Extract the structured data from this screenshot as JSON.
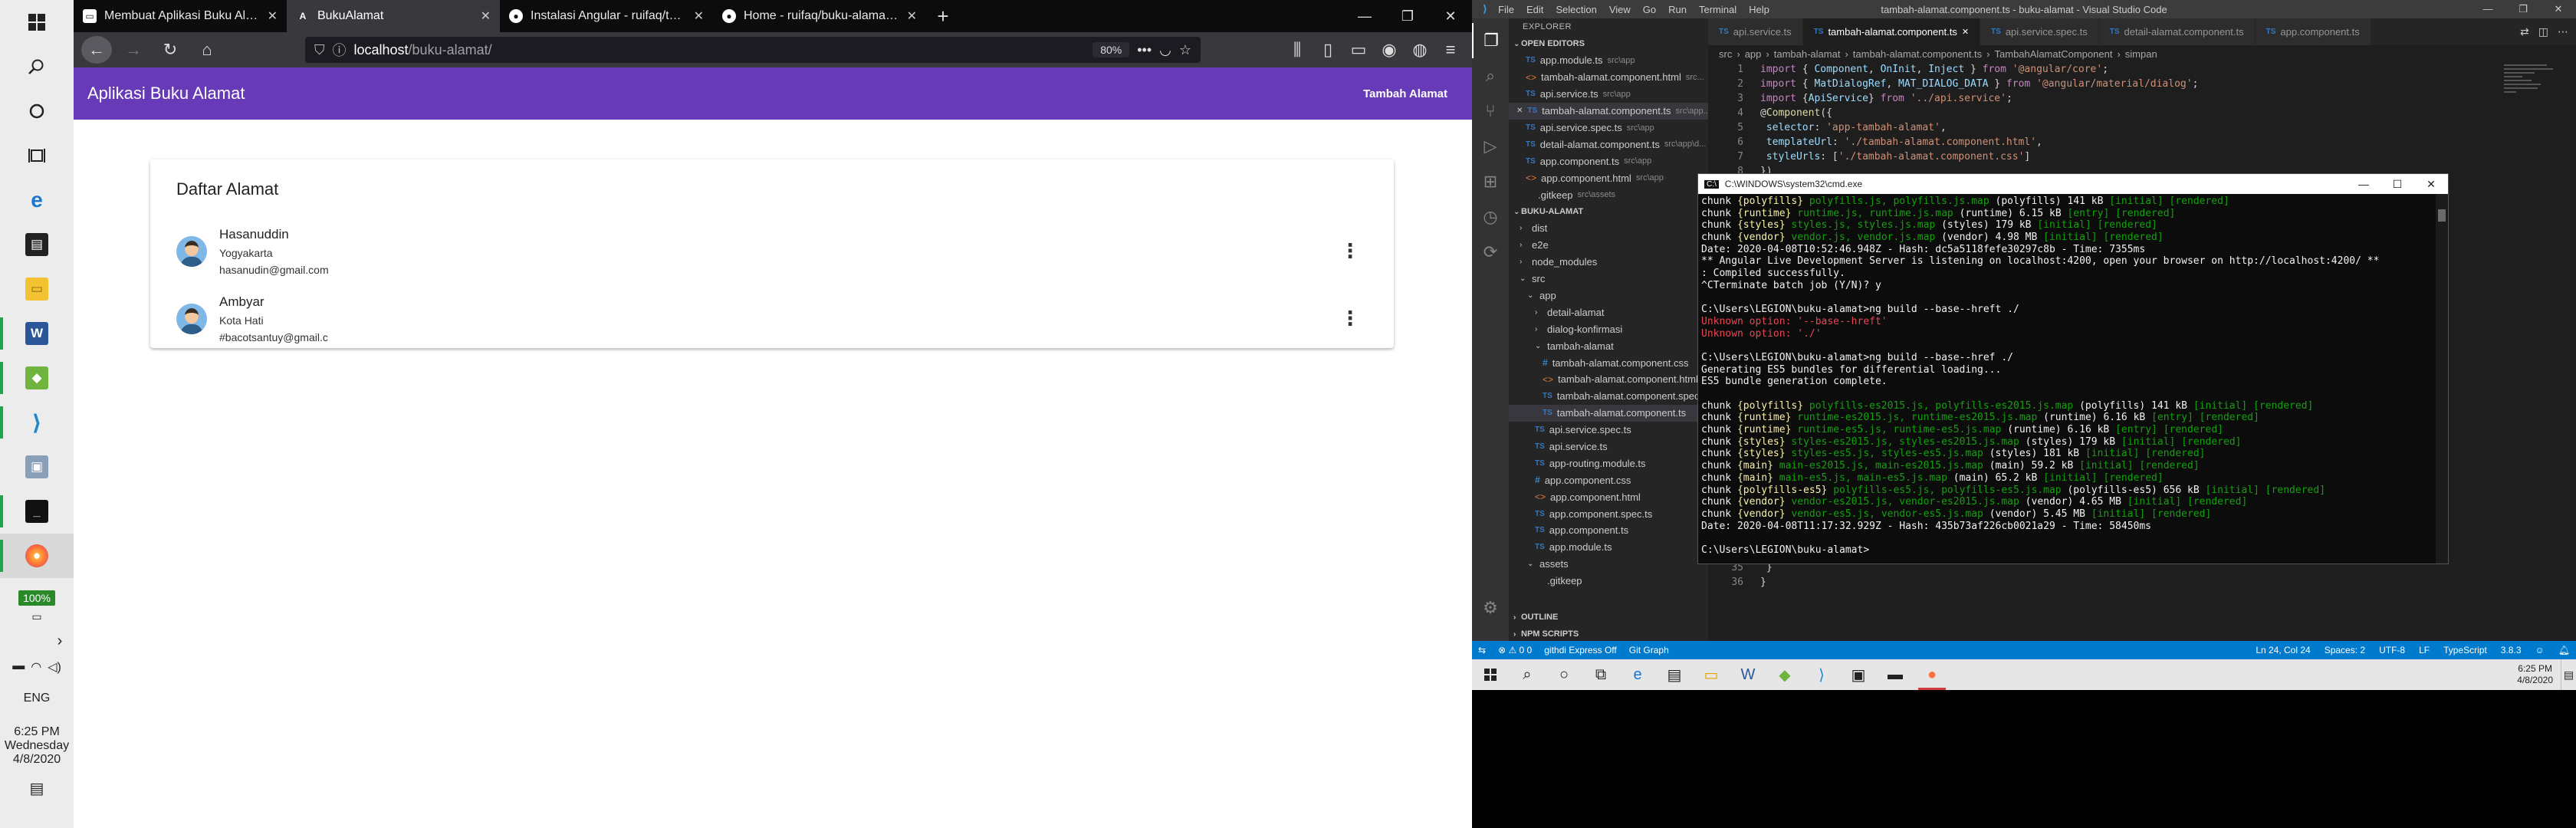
{
  "left_taskbar": {
    "battery": "100%",
    "language": "ENG",
    "time": "6:25 PM",
    "day": "Wednesday",
    "date": "4/8/2020"
  },
  "firefox": {
    "tabs": [
      {
        "title": "Membuat Aplikasi Buku Alamat Me",
        "active": false
      },
      {
        "title": "BukuAlamat",
        "active": true
      },
      {
        "title": "Instalasi Angular - ruifaq/tekw",
        "active": false
      },
      {
        "title": "Home - ruifaq/buku-alamat W",
        "active": false
      }
    ],
    "url_host": "localhost",
    "url_path": "/buku-alamat/",
    "zoom": "80%"
  },
  "app": {
    "title": "Aplikasi Buku Alamat",
    "add_button": "Tambah Alamat",
    "card_title": "Daftar Alamat",
    "addresses": [
      {
        "name": "Hasanuddin",
        "city": "Yogyakarta",
        "email": "hasanudin@gmail.com"
      },
      {
        "name": "Ambyar",
        "city": "Kota Hati",
        "email": "#bacotsantuy@gmail.c"
      }
    ]
  },
  "vscode": {
    "window_title": "tambah-alamat.component.ts - buku-alamat - Visual Studio Code",
    "menus": [
      "File",
      "Edit",
      "Selection",
      "View",
      "Go",
      "Run",
      "Terminal",
      "Help"
    ],
    "explorer_label": "EXPLORER",
    "open_editors_label": "OPEN EDITORS",
    "open_editors": [
      {
        "name": "app.module.ts",
        "path": "src\\app",
        "icon": "ts"
      },
      {
        "name": "tambah-alamat.component.html",
        "path": "src...",
        "icon": "html"
      },
      {
        "name": "api.service.ts",
        "path": "src\\app",
        "icon": "ts"
      },
      {
        "name": "tambah-alamat.component.ts",
        "path": "src\\app...",
        "icon": "ts",
        "selected": true
      },
      {
        "name": "api.service.spec.ts",
        "path": "src\\app",
        "icon": "ts"
      },
      {
        "name": "detail-alamat.component.ts",
        "path": "src\\app\\d...",
        "icon": "ts"
      },
      {
        "name": "app.component.ts",
        "path": "src\\app",
        "icon": "ts"
      },
      {
        "name": "app.component.html",
        "path": "src\\app",
        "icon": "html"
      },
      {
        "name": ".gitkeep",
        "path": "src\\assets",
        "icon": "none"
      }
    ],
    "project_label": "BUKU-ALAMAT",
    "tree": [
      {
        "name": "dist",
        "level": 0,
        "kind": "folder-closed"
      },
      {
        "name": "e2e",
        "level": 0,
        "kind": "folder-closed"
      },
      {
        "name": "node_modules",
        "level": 0,
        "kind": "folder-closed"
      },
      {
        "name": "src",
        "level": 0,
        "kind": "folder-open"
      },
      {
        "name": "app",
        "level": 1,
        "kind": "folder-open"
      },
      {
        "name": "detail-alamat",
        "level": 2,
        "kind": "folder-closed"
      },
      {
        "name": "dialog-konfirmasi",
        "level": 2,
        "kind": "folder-closed"
      },
      {
        "name": "tambah-alamat",
        "level": 2,
        "kind": "folder-open"
      },
      {
        "name": "tambah-alamat.component.css",
        "level": 3,
        "kind": "css"
      },
      {
        "name": "tambah-alamat.component.html",
        "level": 3,
        "kind": "html"
      },
      {
        "name": "tambah-alamat.component.spec.ts",
        "level": 3,
        "kind": "ts"
      },
      {
        "name": "tambah-alamat.component.ts",
        "level": 3,
        "kind": "ts",
        "selected": true
      },
      {
        "name": "api.service.spec.ts",
        "level": 2,
        "kind": "ts"
      },
      {
        "name": "api.service.ts",
        "level": 2,
        "kind": "ts"
      },
      {
        "name": "app-routing.module.ts",
        "level": 2,
        "kind": "ts"
      },
      {
        "name": "app.component.css",
        "level": 2,
        "kind": "css"
      },
      {
        "name": "app.component.html",
        "level": 2,
        "kind": "html"
      },
      {
        "name": "app.component.spec.ts",
        "level": 2,
        "kind": "ts"
      },
      {
        "name": "app.component.ts",
        "level": 2,
        "kind": "ts"
      },
      {
        "name": "app.module.ts",
        "level": 2,
        "kind": "ts"
      },
      {
        "name": "assets",
        "level": 1,
        "kind": "folder-open"
      },
      {
        "name": ".gitkeep",
        "level": 2,
        "kind": "none"
      }
    ],
    "outline_label": "OUTLINE",
    "npm_label": "NPM SCRIPTS",
    "editor_tabs": [
      {
        "name": "api.service.ts",
        "active": false
      },
      {
        "name": "tambah-alamat.component.ts",
        "active": true
      },
      {
        "name": "api.service.spec.ts",
        "active": false
      },
      {
        "name": "detail-alamat.component.ts",
        "active": false
      },
      {
        "name": "app.component.ts",
        "active": false
      }
    ],
    "breadcrumb": [
      "src",
      "app",
      "tambah-alamat",
      "tambah-alamat.component.ts",
      "TambahAlamatComponent",
      "simpan"
    ],
    "code_tail_lines": [
      {
        "num": "35",
        "text": "  }"
      },
      {
        "num": "36",
        "text": "}"
      }
    ],
    "status": {
      "branch": "githdi Express Off",
      "problems": "0  0",
      "git_graph": "Git Graph",
      "position": "Ln 24, Col 24",
      "spaces": "Spaces: 2",
      "encoding": "UTF-8",
      "eol": "LF",
      "language": "TypeScript",
      "version": "3.8.3"
    }
  },
  "cmd": {
    "title": "C:\\WINDOWS\\system32\\cmd.exe",
    "lines": [
      "chunk {polyfills} polyfills.js, polyfills.js.map (polyfills) 141 kB [initial] [rendered]",
      "chunk {runtime} runtime.js, runtime.js.map (runtime) 6.15 kB [entry] [rendered]",
      "chunk {styles} styles.js, styles.js.map (styles) 179 kB [initial] [rendered]",
      "chunk {vendor} vendor.js, vendor.js.map (vendor) 4.98 MB [initial] [rendered]",
      "Date: 2020-04-08T10:52:46.948Z - Hash: dc5a5118fefe30297c8b - Time: 7355ms",
      "** Angular Live Development Server is listening on localhost:4200, open your browser on http://localhost:4200/ **",
      ": Compiled successfully.",
      "^CTerminate batch job (Y/N)? y",
      "",
      "C:\\Users\\LEGION\\buku-alamat>ng build --base--hreft ./",
      "Unknown option: '--base--hreft'",
      "Unknown option: './'",
      "",
      "C:\\Users\\LEGION\\buku-alamat>ng build --base--href ./",
      "Generating ES5 bundles for differential loading...",
      "ES5 bundle generation complete.",
      "",
      "chunk {polyfills} polyfills-es2015.js, polyfills-es2015.js.map (polyfills) 141 kB [initial] [rendered]",
      "chunk {runtime} runtime-es2015.js, runtime-es2015.js.map (runtime) 6.16 kB [entry] [rendered]",
      "chunk {runtime} runtime-es5.js, runtime-es5.js.map (runtime) 6.16 kB [entry] [rendered]",
      "chunk {styles} styles-es2015.js, styles-es2015.js.map (styles) 179 kB [initial] [rendered]",
      "chunk {styles} styles-es5.js, styles-es5.js.map (styles) 181 kB [initial] [rendered]",
      "chunk {main} main-es2015.js, main-es2015.js.map (main) 59.2 kB [initial] [rendered]",
      "chunk {main} main-es5.js, main-es5.js.map (main) 65.2 kB [initial] [rendered]",
      "chunk {polyfills-es5} polyfills-es5.js, polyfills-es5.js.map (polyfills-es5) 656 kB [initial] [rendered]",
      "chunk {vendor} vendor-es2015.js, vendor-es2015.js.map (vendor) 4.65 MB [initial] [rendered]",
      "chunk {vendor} vendor-es5.js, vendor-es5.js.map (vendor) 5.45 MB [initial] [rendered]",
      "Date: 2020-04-08T11:17:32.929Z - Hash: 435b73af226cb0021a29 - Time: 58450ms",
      "",
      "C:\\Users\\LEGION\\buku-alamat>"
    ]
  },
  "bottom_taskbar": {
    "time": "6:25 PM",
    "date": "4/8/2020"
  },
  "colors": {
    "app_bar": "#673ab7",
    "vscode_status": "#007acc",
    "cmd_green": "#13a10e",
    "cmd_red": "#e74856"
  }
}
